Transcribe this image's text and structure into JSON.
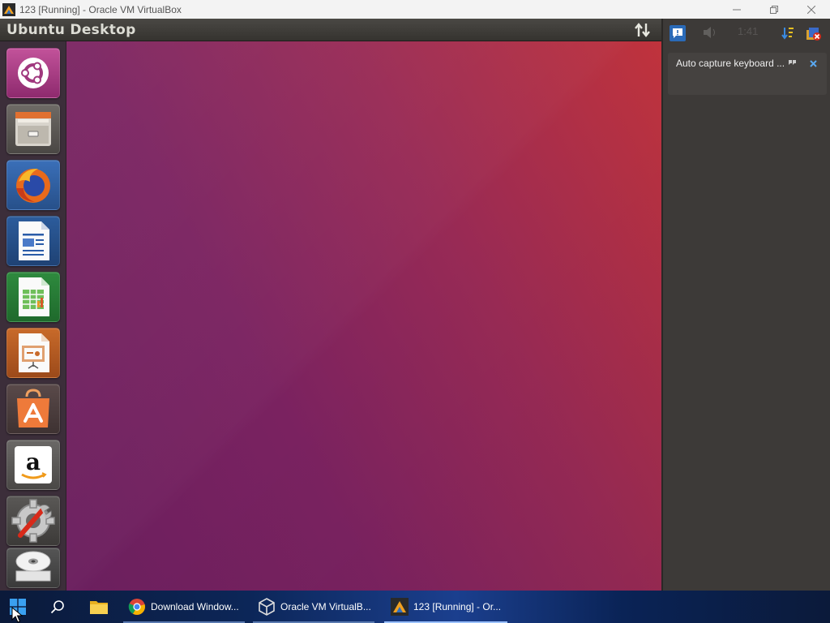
{
  "window": {
    "title": "123 [Running] - Oracle VM VirtualBox",
    "minimize_icon": "minimize-icon",
    "maximize_icon": "restore-icon",
    "close_icon": "close-icon"
  },
  "ubuntu_panel": {
    "title": "Ubuntu Desktop",
    "sync_icon": "up-down-arrows-icon"
  },
  "launcher": {
    "items": [
      {
        "name": "ubuntu-dash",
        "icon": "ubuntu-logo-icon"
      },
      {
        "name": "files",
        "icon": "file-cabinet-icon"
      },
      {
        "name": "firefox",
        "icon": "firefox-icon"
      },
      {
        "name": "libreoffice-writer",
        "icon": "writer-icon"
      },
      {
        "name": "libreoffice-calc",
        "icon": "calc-icon"
      },
      {
        "name": "libreoffice-impress",
        "icon": "impress-icon"
      },
      {
        "name": "ubuntu-software",
        "icon": "software-center-icon"
      },
      {
        "name": "amazon",
        "icon": "amazon-icon"
      },
      {
        "name": "system-settings",
        "icon": "settings-icon"
      },
      {
        "name": "dvd",
        "icon": "disc-icon"
      }
    ]
  },
  "notification_panel": {
    "toolbar_icons": [
      "message-icon",
      "volume-icon",
      "sort-icon",
      "close-all-icon"
    ],
    "faded_clock": "1:41",
    "notification": {
      "text": "Auto capture keyboard ...",
      "expand_icon": "expand-icon",
      "close_icon": "x-icon"
    }
  },
  "taskbar": {
    "start_icon": "windows-start-icon",
    "search_icon": "search-icon",
    "explorer_icon": "folder-icon",
    "apps": [
      {
        "label": "Download Window...",
        "icon": "chrome-icon"
      },
      {
        "label": "Oracle VM VirtualB...",
        "icon": "virtualbox-icon"
      },
      {
        "label": "123 [Running] - Or...",
        "icon": "vm-window-icon"
      }
    ]
  },
  "colors": {
    "desktop_left": "#6a1f5e",
    "desktop_right": "#c0333c",
    "launcher_bg": "#3c2e3a",
    "panel_bg": "#3d3a38"
  }
}
